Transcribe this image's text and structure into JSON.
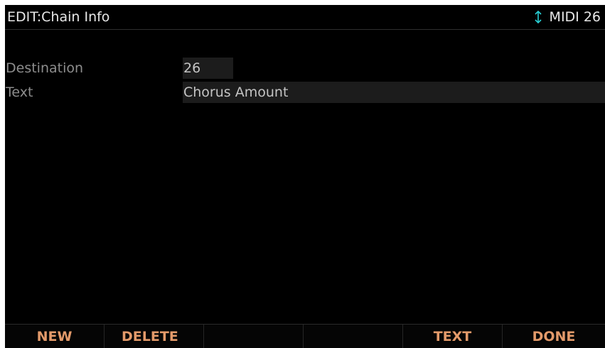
{
  "header": {
    "title": "EDIT:Chain Info",
    "nav_icon": "up-down-arrow-icon",
    "midi_label": "MIDI 26"
  },
  "fields": {
    "destination": {
      "label": "Destination",
      "value": "26"
    },
    "text": {
      "label": "Text",
      "value": "Chorus Amount"
    }
  },
  "softkeys": [
    {
      "label": "NEW"
    },
    {
      "label": "DELETE"
    },
    {
      "label": ""
    },
    {
      "label": ""
    },
    {
      "label": "TEXT"
    },
    {
      "label": "DONE"
    }
  ],
  "colors": {
    "background": "#000000",
    "softkey_text": "#e39a6a",
    "label_text": "#8d8d8d",
    "value_text": "#c4c4c4",
    "value_field_bg": "#1c1c1c"
  }
}
